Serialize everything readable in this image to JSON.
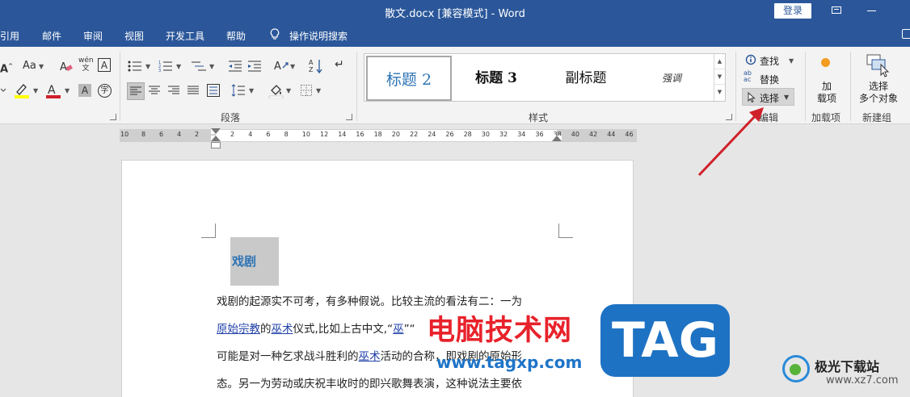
{
  "window": {
    "title": "散文.docx [兼容模式]  -  Word",
    "login_label": "登录"
  },
  "menu": {
    "tabs": [
      "引用",
      "邮件",
      "审阅",
      "视图",
      "开发工具",
      "帮助"
    ],
    "search_label": "操作说明搜索"
  },
  "ribbon": {
    "font_group": {
      "font_size_label": "Aa",
      "phonetic_top": "wén",
      "phonetic_bottom": "文",
      "box_char": "A",
      "shade_char": "A",
      "circle_char": "字"
    },
    "paragraph_group": {
      "label": "段落"
    },
    "styles_group": {
      "label": "样式",
      "items": [
        "标题 2",
        "标题 3",
        "副标题",
        "强调"
      ]
    },
    "editing_group": {
      "label": "编辑",
      "find": "查找",
      "replace": "替换",
      "select": "选择"
    },
    "addins_group": {
      "label": "加载项",
      "button_line1": "加",
      "button_line2": "载项"
    },
    "newgroup": {
      "label": "新建组",
      "button_line1": "选择",
      "button_line2": "多个对象"
    }
  },
  "ruler": {
    "left_ticks": [
      "10",
      "8",
      "6",
      "4",
      "2"
    ],
    "right_ticks": [
      "2",
      "4",
      "6",
      "8",
      "10",
      "12",
      "14",
      "16",
      "18",
      "20",
      "22",
      "24",
      "26",
      "28",
      "30",
      "32",
      "34",
      "36",
      "38",
      "40",
      "42",
      "44",
      "46"
    ]
  },
  "document": {
    "heading": "戏剧",
    "line1": "戏剧的起源实不可考，有多种假说。比较主流的看法有二：一为",
    "line2_link1": "原始宗教",
    "line2_mid1": "的",
    "line2_link2": "巫术",
    "line2_mid2": "仪式,比如上古中文,“",
    "line2_link3": "巫",
    "line2_rest": "”“",
    "line3_pre": "可能是对一种乞求战斗胜利的",
    "line3_link": "巫术",
    "line3_rest": "活动的合称，即戏剧的原始形",
    "line4": "态。另一为劳动或庆祝丰收时的即兴歌舞表演，这种说法主要依"
  },
  "watermark": {
    "cn": "电脑技术网",
    "url": "www.tagxp.com",
    "tag": "TAG",
    "site_name": "极光下载站",
    "site_url": "www.xz7.com"
  },
  "colors": {
    "title_bar": "#2b579a",
    "heading_blue": "#2e74b5",
    "arrow_red": "#d0202a"
  }
}
